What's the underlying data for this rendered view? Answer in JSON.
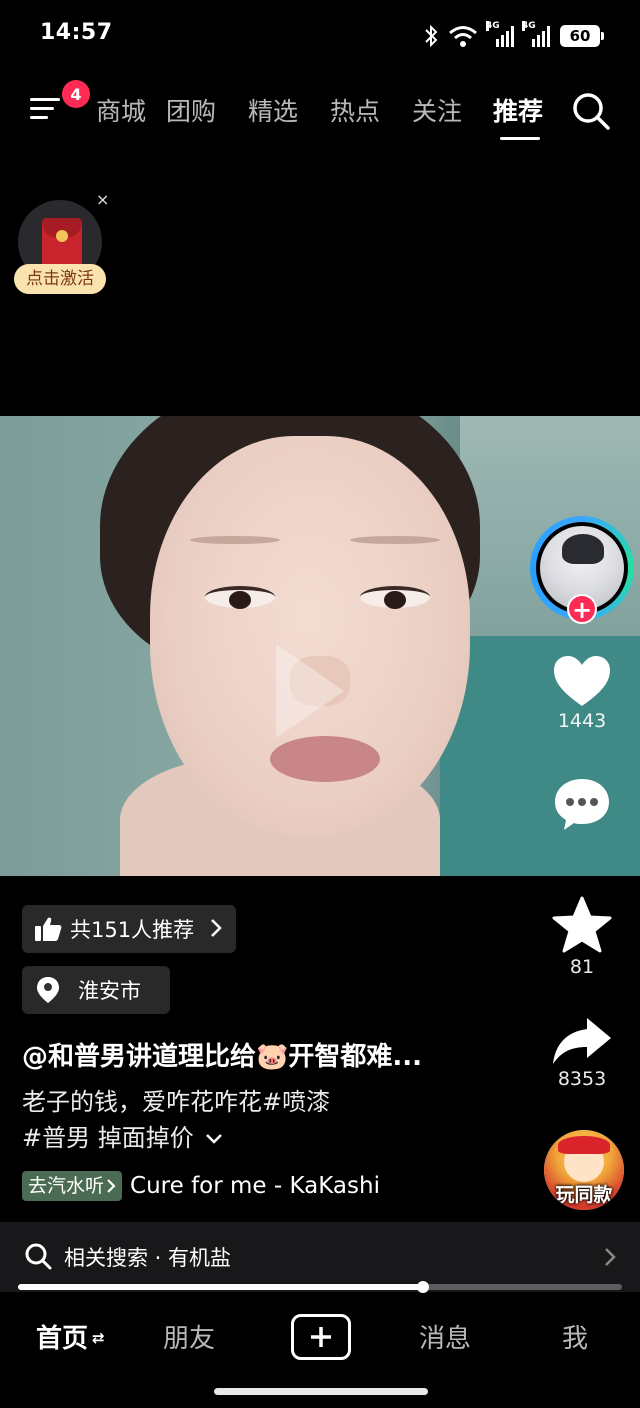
{
  "status_bar": {
    "time": "14:57",
    "network_1": "4G",
    "network_2": "4G",
    "battery": "60"
  },
  "top_nav": {
    "menu_badge": "4",
    "tabs": [
      {
        "label": "商城"
      },
      {
        "label": "团购"
      },
      {
        "label": "精选"
      },
      {
        "label": "热点"
      },
      {
        "label": "关注"
      },
      {
        "label": "推荐",
        "active": true
      }
    ]
  },
  "red_packet": {
    "label": "点击激活",
    "close": "×"
  },
  "right_rail": {
    "like_count": "1443",
    "favorite_count": "81",
    "share_count": "8353",
    "same_style_label": "玩同款"
  },
  "info": {
    "recommend_chip": "共151人推荐",
    "location_chip": "淮安市",
    "author_title": "@和普男讲道理比给🐷开智都难...",
    "description_line1": "老子的钱，爱咋花咋花#喷漆",
    "description_line2": "#普男 掉面掉价",
    "music_tag": "去汽水听",
    "music_song": "Cure  for me - KaKashi"
  },
  "related_search": {
    "label": "相关搜索 · 有机盐"
  },
  "playback": {
    "progress_fraction": 0.67
  },
  "bottom_nav": {
    "home": "首页",
    "friends": "朋友",
    "messages": "消息",
    "me": "我"
  },
  "colors": {
    "accent_red": "#fe2c55",
    "music_tag_bg": "#4b6b52"
  }
}
